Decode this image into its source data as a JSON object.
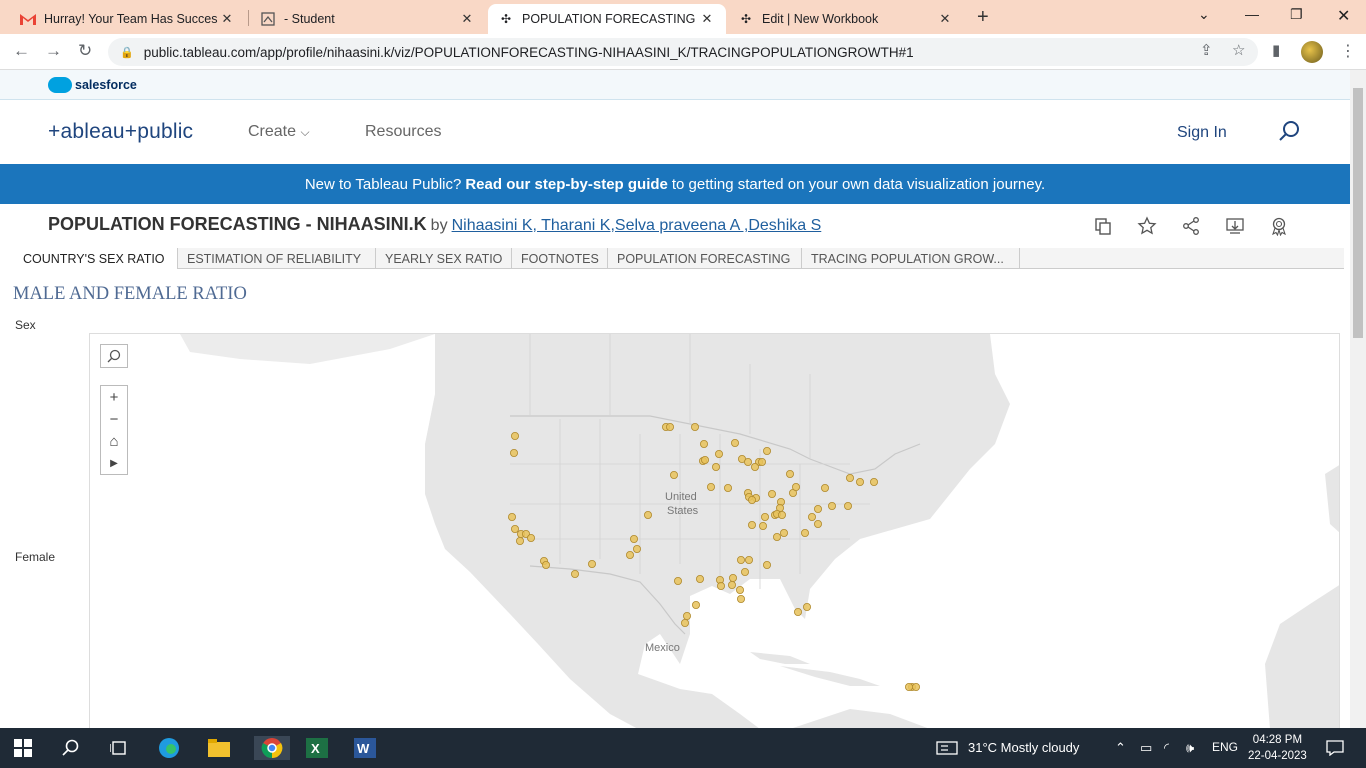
{
  "browser": {
    "tabs": [
      {
        "title": "Hurray! Your Team Has Successfu",
        "icon": "gmail-icon"
      },
      {
        "title": "- Student",
        "icon": "student-icon"
      },
      {
        "title": "POPULATION FORECASTING - NI",
        "icon": "tableau-icon"
      },
      {
        "title": "Edit | New Workbook",
        "icon": "tableau-icon"
      }
    ],
    "url": "public.tableau.com/app/profile/nihaasini.k/viz/POPULATIONFORECASTING-NIHAASINI_K/TRACINGPOPULATIONGROWTH#1"
  },
  "salesforce": {
    "label": "salesforce"
  },
  "header": {
    "logo": "+ableau+public",
    "nav": [
      "Create",
      "Resources"
    ],
    "signin": "Sign In"
  },
  "banner": {
    "prefix": "New to Tableau Public?",
    "link": "Read our step-by-step guide",
    "suffix": "to getting started on your own data visualization journey."
  },
  "viz": {
    "title": "POPULATION FORECASTING - NIHAASINI.K",
    "by": "by",
    "authors": "Nihaasini K, Tharani K,Selva praveena A ,Deshika S",
    "sheets": [
      "COUNTRY'S SEX RATIO",
      "ESTIMATION OF RELIABILITY",
      "YEARLY SEX RATIO",
      "FOOTNOTES",
      "POPULATION FORECASTING",
      "TRACING POPULATION GROW..."
    ],
    "active_sheet": 0,
    "worksheet_title": "MALE AND FEMALE RATIO",
    "column_header": "Sex",
    "row_label": "Female",
    "map_labels": {
      "us1": "United",
      "us2": "States",
      "mexico": "Mexico"
    },
    "marker_color": "#e8c25a"
  },
  "taskbar": {
    "weather": "31°C  Mostly cloudy",
    "lang": "ENG",
    "time": "04:28 PM",
    "date": "22-04-2023"
  }
}
